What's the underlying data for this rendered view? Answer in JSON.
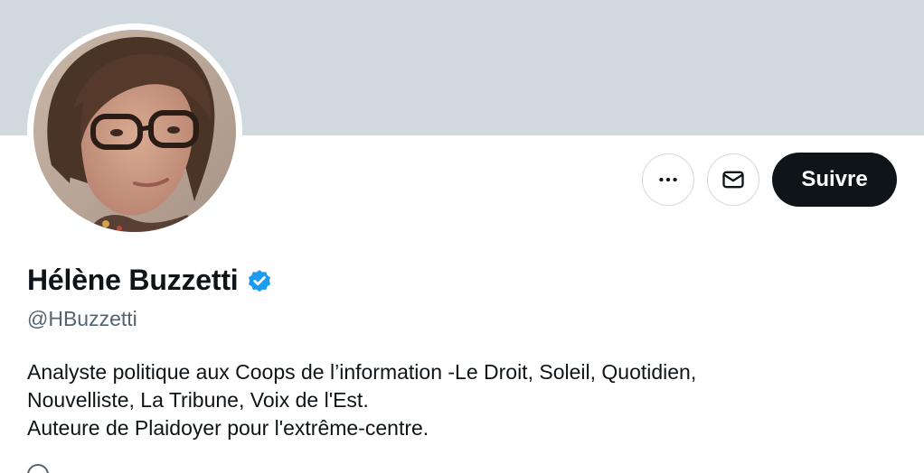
{
  "profile": {
    "display_name": "Hélène Buzzetti",
    "handle": "@HBuzzetti",
    "verified": true,
    "bio_lines": [
      "Analyste politique aux Coops de l’information -Le Droit, Soleil, Quotidien,",
      "Nouvelliste, La Tribune, Voix de l'Est.",
      "Auteure de Plaidoyer pour l'extrême-centre."
    ]
  },
  "actions": {
    "more_icon": "more-horizontal-icon",
    "message_icon": "mail-icon",
    "follow_label": "Suivre"
  },
  "colors": {
    "banner": "#cfd9de",
    "text_primary": "#0f1419",
    "text_secondary": "#536471",
    "verified_badge": "#1d9bf0",
    "follow_button_bg": "#0f1419",
    "follow_button_text": "#ffffff"
  }
}
